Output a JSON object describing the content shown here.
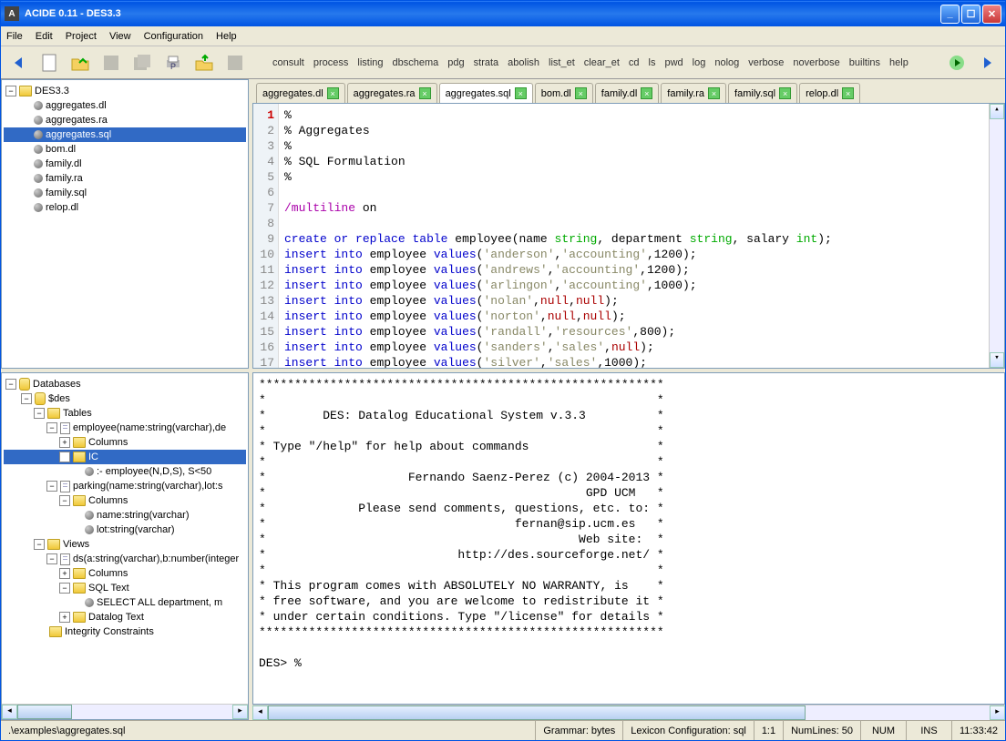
{
  "title": "ACIDE 0.11 - DES3.3",
  "menu": [
    "File",
    "Edit",
    "Project",
    "View",
    "Configuration",
    "Help"
  ],
  "commands": [
    "consult",
    "process",
    "listing",
    "dbschema",
    "pdg",
    "strata",
    "abolish",
    "list_et",
    "clear_et",
    "cd",
    "ls",
    "pwd",
    "log",
    "nolog",
    "verbose",
    "noverbose",
    "builtins",
    "help"
  ],
  "project": {
    "root": "DES3.3",
    "files": [
      "aggregates.dl",
      "aggregates.ra",
      "aggregates.sql",
      "bom.dl",
      "family.dl",
      "family.ra",
      "family.sql",
      "relop.dl"
    ],
    "selected": "aggregates.sql"
  },
  "tabs": [
    {
      "label": "aggregates.dl"
    },
    {
      "label": "aggregates.ra"
    },
    {
      "label": "aggregates.sql",
      "active": true
    },
    {
      "label": "bom.dl"
    },
    {
      "label": "family.dl"
    },
    {
      "label": "family.ra"
    },
    {
      "label": "family.sql"
    },
    {
      "label": "relop.dl"
    }
  ],
  "editor": {
    "current_line": 1,
    "lines": [
      "%",
      "% Aggregates",
      "%",
      "% SQL Formulation",
      "%",
      "",
      "/multiline on",
      "",
      "create or replace table employee(name string, department string, salary int);",
      "insert into employee values('anderson','accounting',1200);",
      "insert into employee values('andrews','accounting',1200);",
      "insert into employee values('arlingon','accounting',1000);",
      "insert into employee values('nolan',null,null);",
      "insert into employee values('norton',null,null);",
      "insert into employee values('randall','resources',800);",
      "insert into employee values('sanders','sales',null);",
      "insert into employee values('silver','sales',1000);"
    ]
  },
  "db": {
    "root": "Databases",
    "dbname": "$des",
    "tables_label": "Tables",
    "table1": "employee(name:string(varchar),de",
    "columns_label": "Columns",
    "ic_label": "IC",
    "ic_rule": ":- employee(N,D,S), S<50",
    "table2": "parking(name:string(varchar),lot:s",
    "col1": "name:string(varchar)",
    "col2": "lot:string(varchar)",
    "views_label": "Views",
    "view1": "ds(a:string(varchar),b:number(integer",
    "sqltext_label": "SQL Text",
    "sqltext": "SELECT ALL department, m",
    "datalog_label": "Datalog Text",
    "ic_top": "Integrity Constraints"
  },
  "console_lines": [
    "*********************************************************",
    "*                                                       *",
    "*        DES: Datalog Educational System v.3.3          *",
    "*                                                       *",
    "* Type \"/help\" for help about commands                  *",
    "*                                                       *",
    "*                    Fernando Saenz-Perez (c) 2004-2013 *",
    "*                                             GPD UCM   *",
    "*             Please send comments, questions, etc. to: *",
    "*                                   fernan@sip.ucm.es   *",
    "*                                            Web site:  *",
    "*                           http://des.sourceforge.net/ *",
    "*                                                       *",
    "* This program comes with ABSOLUTELY NO WARRANTY, is    *",
    "* free software, and you are welcome to redistribute it *",
    "* under certain conditions. Type \"/license\" for details *",
    "*********************************************************",
    "",
    "DES> %"
  ],
  "status": {
    "path": ".\\examples\\aggregates.sql",
    "grammar": "Grammar: bytes",
    "lexicon": "Lexicon Configuration: sql",
    "pos": "1:1",
    "numlines": "NumLines: 50",
    "num": "NUM",
    "ins": "INS",
    "time": "11:33:42"
  }
}
